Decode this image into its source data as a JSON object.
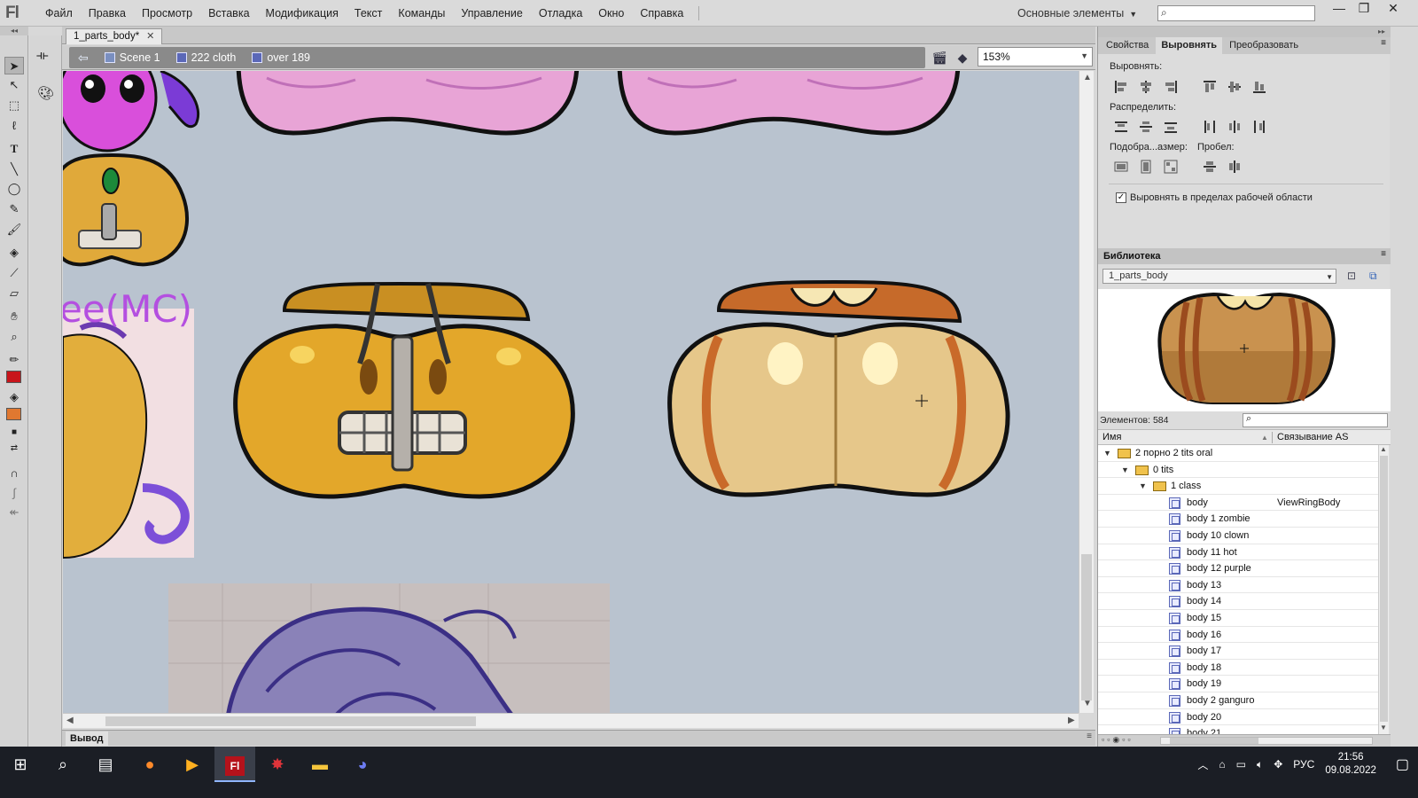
{
  "app": {
    "logo": "Fl"
  },
  "menu": [
    "Файл",
    "Правка",
    "Просмотр",
    "Вставка",
    "Модификация",
    "Текст",
    "Команды",
    "Управление",
    "Отладка",
    "Окно",
    "Справка"
  ],
  "workspace": "Основные элементы",
  "document": {
    "tab": "1_parts_body*",
    "breadcrumbs": [
      "Scene 1",
      "222 cloth",
      "over 189"
    ],
    "zoom": "153%"
  },
  "stage": {
    "partial_text": "ee(MC)"
  },
  "output_tab": "Вывод",
  "panel": {
    "tabs": [
      "Свойства",
      "Выровнять",
      "Преобразовать"
    ],
    "active_tab": "Выровнять",
    "align_label": "Выровнять:",
    "distribute_label": "Распределить:",
    "match_size_label": "Подобра...азмер:",
    "space_label": "Пробел:",
    "checkbox_label": "Выровнять в пределах рабочей области",
    "checkbox_checked": true
  },
  "library": {
    "title": "Библиотека",
    "selected_doc": "1_parts_body",
    "count": "Элементов: 584",
    "col_name": "Имя",
    "col_linkage": "Связывание AS",
    "rows": [
      {
        "name": "2 порно 2 tits oral",
        "type": "folder",
        "level": 0,
        "as": ""
      },
      {
        "name": "0 tits",
        "type": "folder",
        "level": 1,
        "as": ""
      },
      {
        "name": "1 class",
        "type": "folder",
        "level": 2,
        "as": ""
      },
      {
        "name": "body",
        "type": "symbol",
        "level": 3,
        "as": "ViewRingBody"
      },
      {
        "name": "body 1 zombie",
        "type": "symbol",
        "level": 3,
        "as": ""
      },
      {
        "name": "body 10 clown",
        "type": "symbol",
        "level": 3,
        "as": ""
      },
      {
        "name": "body 11 hot",
        "type": "symbol",
        "level": 3,
        "as": ""
      },
      {
        "name": "body 12 purple",
        "type": "symbol",
        "level": 3,
        "as": ""
      },
      {
        "name": "body 13",
        "type": "symbol",
        "level": 3,
        "as": ""
      },
      {
        "name": "body 14",
        "type": "symbol",
        "level": 3,
        "as": ""
      },
      {
        "name": "body 15",
        "type": "symbol",
        "level": 3,
        "as": ""
      },
      {
        "name": "body 16",
        "type": "symbol",
        "level": 3,
        "as": ""
      },
      {
        "name": "body 17",
        "type": "symbol",
        "level": 3,
        "as": ""
      },
      {
        "name": "body 18",
        "type": "symbol",
        "level": 3,
        "as": ""
      },
      {
        "name": "body 19",
        "type": "symbol",
        "level": 3,
        "as": ""
      },
      {
        "name": "body 2 ganguro",
        "type": "symbol",
        "level": 3,
        "as": ""
      },
      {
        "name": "body 20",
        "type": "symbol",
        "level": 3,
        "as": ""
      },
      {
        "name": "body 21",
        "type": "symbol",
        "level": 3,
        "as": ""
      }
    ]
  },
  "taskbar": {
    "lang": "РУС",
    "time": "21:56",
    "date": "09.08.2022"
  }
}
